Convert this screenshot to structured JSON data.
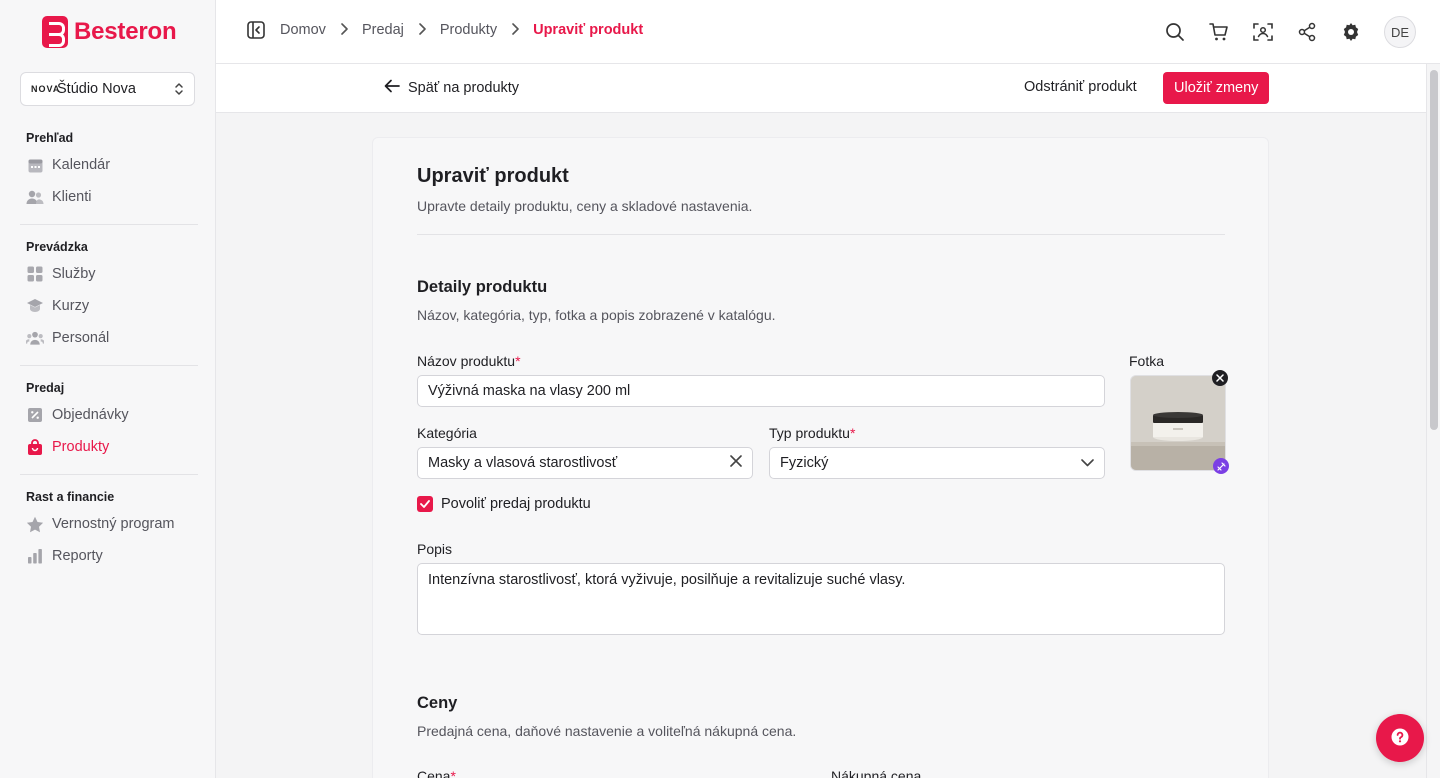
{
  "brand": {
    "name": "Besteron",
    "accent": "#e8184a"
  },
  "studio": {
    "mark": "NOVA",
    "name": "Štúdio Nova"
  },
  "sidebar": {
    "groups": [
      {
        "title": "Prehľad",
        "items": [
          {
            "label": "Kalendár",
            "icon": "calendar-icon"
          },
          {
            "label": "Klienti",
            "icon": "users-icon"
          }
        ]
      },
      {
        "title": "Prevádzka",
        "items": [
          {
            "label": "Služby",
            "icon": "grid-icon"
          },
          {
            "label": "Kurzy",
            "icon": "graduation-cap-icon"
          },
          {
            "label": "Personál",
            "icon": "team-icon"
          }
        ]
      },
      {
        "title": "Predaj",
        "items": [
          {
            "label": "Objednávky",
            "icon": "receipt-icon"
          },
          {
            "label": "Produkty",
            "icon": "shopping-bag-icon",
            "active": true
          }
        ]
      },
      {
        "title": "Rast a financie",
        "items": [
          {
            "label": "Vernostný program",
            "icon": "star-icon"
          },
          {
            "label": "Reporty",
            "icon": "bar-chart-icon"
          }
        ]
      }
    ]
  },
  "breadcrumb": {
    "items": [
      "Domov",
      "Predaj",
      "Produkty"
    ],
    "current": "Upraviť produkt"
  },
  "topbar": {
    "avatar": "DE"
  },
  "actions": {
    "back": "Späť na produkty",
    "delete": "Odstrániť produkt",
    "save": "Uložiť zmeny"
  },
  "page": {
    "title": "Upraviť produkt",
    "subtitle": "Upravte detaily produktu, ceny a skladové nastavenia."
  },
  "details": {
    "title": "Detaily produktu",
    "subtitle": "Názov, kategória, typ, fotka a popis zobrazené v katalógu.",
    "name_label": "Názov produktu",
    "name_value": "Výživná maska na vlasy 200 ml",
    "photo_label": "Fotka",
    "category_label": "Kategória",
    "category_value": "Masky a vlasová starostlivosť",
    "type_label": "Typ produktu",
    "type_value": "Fyzický",
    "sale_checkbox": "Povoliť predaj produktu",
    "sale_checked": true,
    "desc_label": "Popis",
    "desc_value": "Intenzívna starostlivosť, ktorá vyživuje, posilňuje a revitalizuje suché vlasy."
  },
  "prices": {
    "title": "Ceny",
    "subtitle": "Predajná cena, daňové nastavenie a voliteľná nákupná cena.",
    "price_label": "Cena",
    "purchase_label": "Nákupná cena"
  }
}
